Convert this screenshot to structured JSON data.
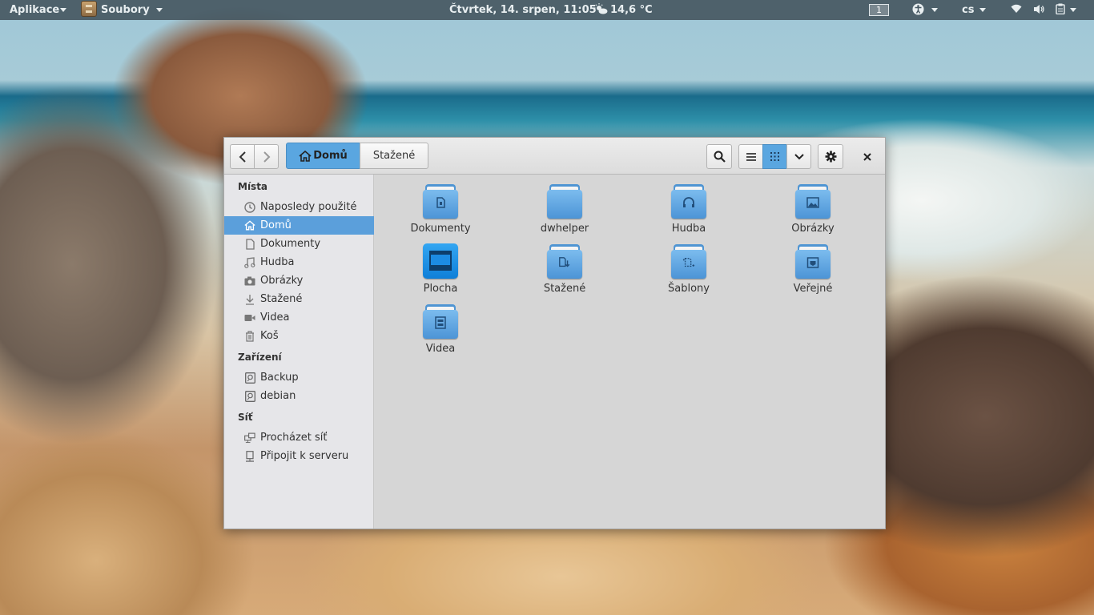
{
  "topbar": {
    "apps_label": "Aplikace",
    "files_label": "Soubory",
    "clock": "Čtvrtek, 14. srpen, 11:05",
    "weather": "14,6 °C",
    "workspace": "1",
    "language": "cs"
  },
  "window": {
    "path": [
      "Domů",
      "Stažené"
    ],
    "sidebar": {
      "sections": [
        {
          "title": "Místa",
          "items": [
            "Naposledy použité",
            "Domů",
            "Dokumenty",
            "Hudba",
            "Obrázky",
            "Stažené",
            "Videa",
            "Koš"
          ]
        },
        {
          "title": "Zařízení",
          "items": [
            "Backup",
            "debian"
          ]
        },
        {
          "title": "Síť",
          "items": [
            "Procházet síť",
            "Připojit k serveru"
          ]
        }
      ],
      "selected": "Domů"
    },
    "files": [
      {
        "name": "Dokumenty",
        "icon": "document-folder-icon"
      },
      {
        "name": "dwhelper",
        "icon": "folder-icon"
      },
      {
        "name": "Hudba",
        "icon": "music-folder-icon"
      },
      {
        "name": "Obrázky",
        "icon": "pictures-folder-icon"
      },
      {
        "name": "Plocha",
        "icon": "desktop-folder-icon"
      },
      {
        "name": "Stažené",
        "icon": "downloads-folder-icon"
      },
      {
        "name": "Šablony",
        "icon": "templates-folder-icon"
      },
      {
        "name": "Veřejné",
        "icon": "public-folder-icon"
      },
      {
        "name": "Videa",
        "icon": "videos-folder-icon"
      }
    ]
  },
  "colors": {
    "accent": "#5b9fdb",
    "folder": "#5fa6e2",
    "topbar": "#465862"
  }
}
